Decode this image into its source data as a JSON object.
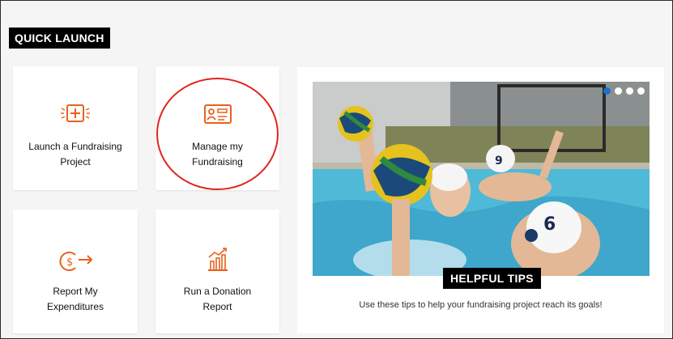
{
  "section_title": "QUICK LAUNCH",
  "tiles": [
    {
      "label_line1": "Launch a Fundraising",
      "label_line2": "Project",
      "icon": "add-project-icon"
    },
    {
      "label_line1": "Manage my",
      "label_line2": "Fundraising",
      "icon": "id-card-icon"
    },
    {
      "label_line1": "Report My",
      "label_line2": "Expenditures",
      "icon": "dollar-arrow-icon"
    },
    {
      "label_line1": "Run a Donation",
      "label_line2": "Report",
      "icon": "bar-chart-growth-icon"
    }
  ],
  "tips": {
    "badge": "HELPFUL TIPS",
    "description": "Use these tips to help your fundraising project reach its goals!",
    "carousel_active_index": 0,
    "carousel_count": 4
  },
  "colors": {
    "accent": "#e8611a",
    "highlight": "#e0241b",
    "carousel_active": "#1b73c9"
  }
}
